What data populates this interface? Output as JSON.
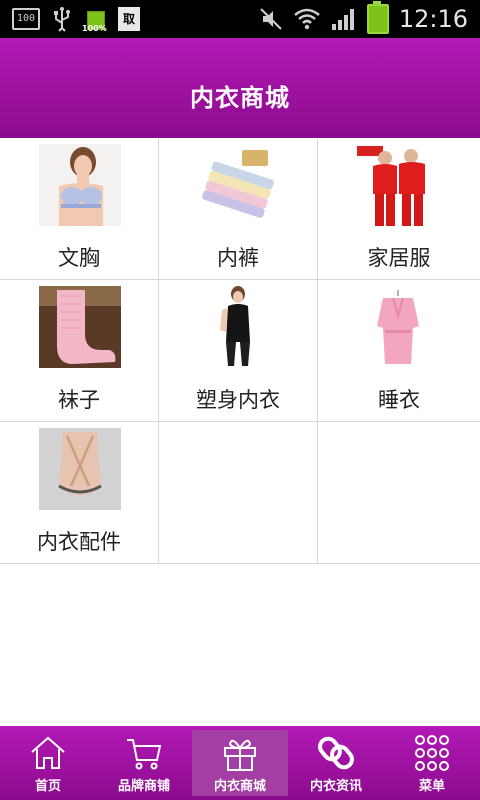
{
  "status_bar": {
    "badge_text": "100",
    "battery_small_text": "100%",
    "doc_icon_text": "取",
    "time": "12:16"
  },
  "header": {
    "title": "内衣商城"
  },
  "categories": [
    {
      "label": "文胸",
      "icon": "bra-photo"
    },
    {
      "label": "内裤",
      "icon": "panties-photo"
    },
    {
      "label": "家居服",
      "icon": "homewear-photo"
    },
    {
      "label": "袜子",
      "icon": "socks-photo"
    },
    {
      "label": "塑身内衣",
      "icon": "shapewear-photo"
    },
    {
      "label": "睡衣",
      "icon": "pajamas-photo"
    },
    {
      "label": "内衣配件",
      "icon": "accessory-photo"
    }
  ],
  "bottom_nav": [
    {
      "label": "首页",
      "icon": "home-icon"
    },
    {
      "label": "品牌商铺",
      "icon": "cart-icon"
    },
    {
      "label": "内衣商城",
      "icon": "gift-icon",
      "active": true
    },
    {
      "label": "内衣资讯",
      "icon": "link-icon"
    },
    {
      "label": "菜单",
      "icon": "grid-menu-icon"
    }
  ],
  "colors": {
    "brand": "#9c12a0",
    "active_tab": "#a33ea4"
  }
}
